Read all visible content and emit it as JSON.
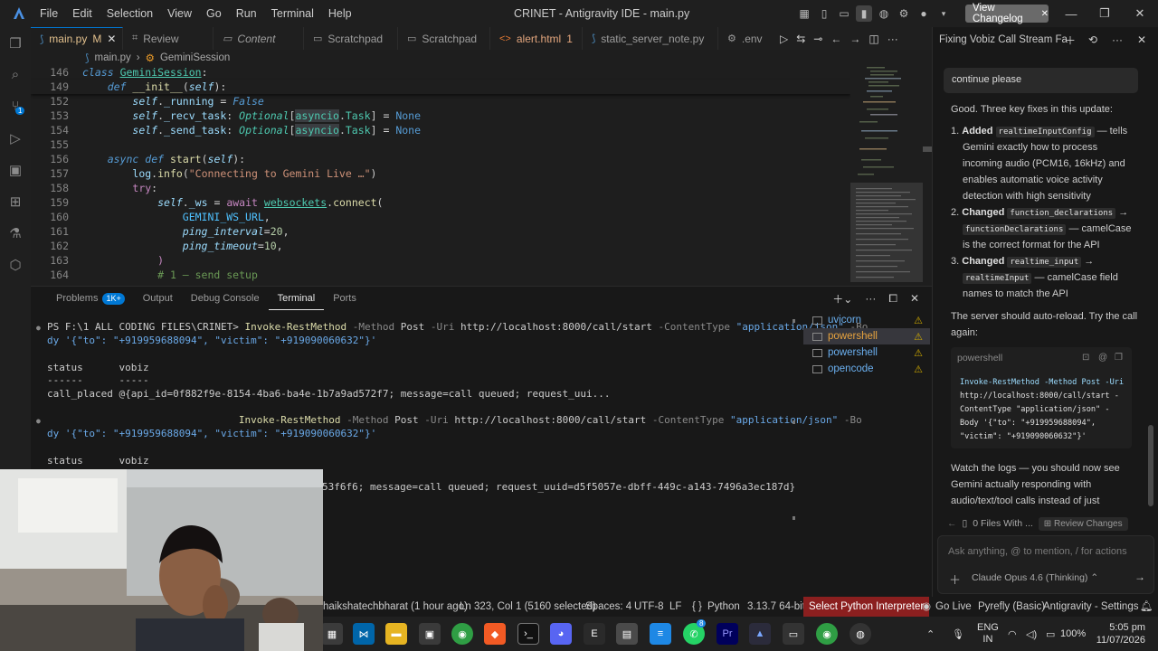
{
  "window": {
    "title": "CRINET - Antigravity IDE - main.py",
    "menu": [
      "File",
      "Edit",
      "Selection",
      "View",
      "Go",
      "Run",
      "Terminal",
      "Help"
    ],
    "changelog_label": "View Changelog"
  },
  "activity": {
    "scm_badge": "1"
  },
  "tabs": [
    {
      "label": "main.py",
      "suffix": "M",
      "active": true
    },
    {
      "label": "Review"
    },
    {
      "label": "Content"
    },
    {
      "label": "Scratchpad"
    },
    {
      "label": "Scratchpad"
    },
    {
      "label": "alert.html",
      "suffix": "1"
    },
    {
      "label": "static_server_note.py"
    },
    {
      "label": ".env"
    }
  ],
  "breadcrumb": {
    "file": "main.py",
    "symbol": "GeminiSession"
  },
  "code": {
    "lines": [
      "146",
      "149",
      "152",
      "153",
      "154",
      "155",
      "156",
      "157",
      "158",
      "159",
      "160",
      "161",
      "162",
      "163",
      "164"
    ]
  },
  "panel": {
    "tabs": [
      "Problems",
      "Output",
      "Debug Console",
      "Terminal",
      "Ports"
    ],
    "problems_badge": "1K+",
    "terminal": {
      "prompt": "PS F:\\1 ALL CODING FILES\\CRINET>",
      "cmd": "Invoke-RestMethod",
      "method_flag": "-Method",
      "method": "Post",
      "uri_flag": "-Uri",
      "uri": "http://localhost:8000/call/start",
      "ct_flag": "-ContentType",
      "ct": "\"application/json\"",
      "body_tail": "-Bo",
      "body_line": "dy '{\"to\": \"+919959688094\", \"victim\": \"+919090060632\"}'",
      "col1": "status",
      "col2": "vobiz",
      "dash1": "------",
      "dash2": "-----",
      "row1_status": "call_placed",
      "row1_vobiz": "@{api_id=0f882f9e-8154-4ba6-ba4e-1b7a9ad572f7; message=call queued; request_uui...",
      "row2_tail": "53f6f6; message=call queued; request_uuid=d5f5057e-dbff-449c-a143-7496a3ec187d}"
    },
    "terminal_list": [
      {
        "label": "uvicorn"
      },
      {
        "label": "powershell",
        "selected": true
      },
      {
        "label": "powershell"
      },
      {
        "label": "opencode"
      }
    ]
  },
  "chat": {
    "title": "Fixing Vobiz Call Stream Fa",
    "user_message": "continue please",
    "intro": "Good. Three key fixes in this update:",
    "items": [
      {
        "num": "1.",
        "bold": "Added",
        "code": "realtimeInputConfig",
        "rest": "— tells",
        "more": [
          "Gemini exactly how to process",
          "incoming audio (PCM16, 16kHz) and",
          "enables automatic voice activity",
          "detection with high sensitivity"
        ]
      },
      {
        "num": "2.",
        "bold": "Changed",
        "code": "function_declarations",
        "rest": "→",
        "code2": "functionDeclarations",
        "rest2": "— camelCase",
        "more": [
          "is the correct format for the API"
        ]
      },
      {
        "num": "3.",
        "bold": "Changed",
        "code": "realtime_input",
        "rest": "→",
        "code2": "realtimeInput",
        "rest2": "— camelCase field",
        "more": [
          "names to match the API"
        ]
      }
    ],
    "reload_lines": [
      "The server should auto-reload. Try the call",
      "again:"
    ],
    "code_block": {
      "lang": "powershell",
      "lines": [
        "Invoke-RestMethod -Method Post -Uri",
        "http://localhost:8000/call/start -",
        "ContentType \"application/json\" -",
        "Body '{\"to\": \"+919959688094\",",
        "\"victim\": \"+919090060632\"}'"
      ]
    },
    "watch_lines": [
      "Watch the logs — you should now see",
      "Gemini actually responding with",
      "audio/text/tool calls instead of just"
    ],
    "files_label": "0 Files With ...",
    "review_changes": "Review Changes",
    "input_placeholder": "Ask anything, @ to mention, / for actions",
    "model": "Claude Opus 4.6 (Thinking)"
  },
  "statusbar": {
    "git": "haikshatechbharat (1 hour ago)",
    "position": "Ln 323, Col 1 (5160 selected)",
    "spaces": "Spaces: 4",
    "encoding": "UTF-8",
    "eol": "LF",
    "language": "Python",
    "interpreter": "3.13.7 64-bit",
    "select_interpreter": "Select Python Interpreter",
    "golive": "Go Live",
    "pyrefly": "Pyrefly (Basic)",
    "settings": "Antigravity - Settings"
  },
  "taskbar": {
    "lang": "ENG",
    "region": "IN",
    "battery": "100%",
    "time": "5:05 pm",
    "date": "11/07/2026",
    "whatsapp_badge": "8"
  }
}
